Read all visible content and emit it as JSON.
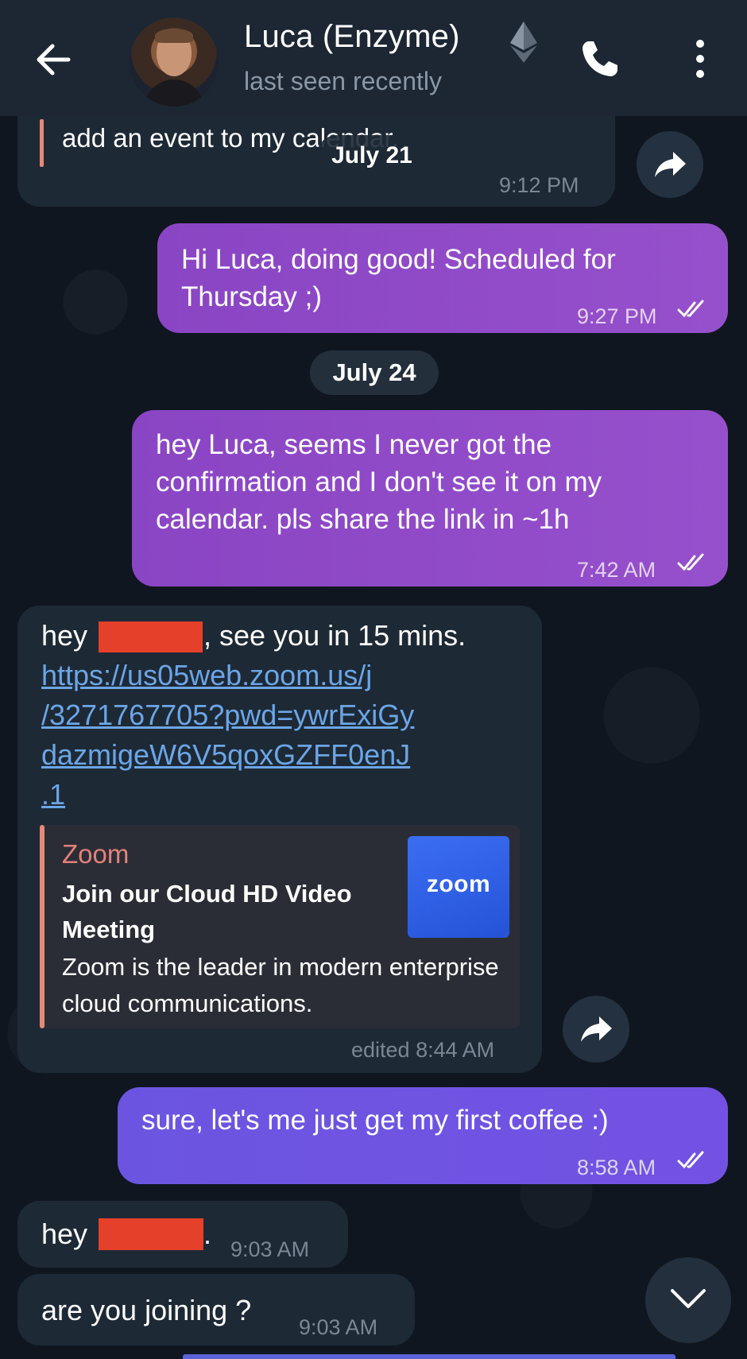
{
  "header": {
    "contact_name": "Luca (Enzyme)",
    "status": "last seen recently",
    "back_icon": "back-arrow-icon",
    "call_icon": "phone-icon",
    "menu_icon": "more-vertical-icon"
  },
  "messages": [
    {
      "id": "m0",
      "direction": "incoming",
      "text": "add an event to my calendar.",
      "time": "9:12 PM"
    },
    {
      "id": "m1",
      "direction": "outgoing",
      "lines": [
        "Hi Luca, doing good! Scheduled for",
        "Thursday ;)"
      ],
      "time": "9:27 PM",
      "read": true
    },
    {
      "id": "m2",
      "direction": "outgoing",
      "lines": [
        "hey Luca, seems I never got the",
        "confirmation and I don't see it on my",
        "calendar. pls share the  link in ~1h"
      ],
      "time": "7:42 AM",
      "read": true
    },
    {
      "id": "m3",
      "direction": "incoming",
      "greeting": "hey",
      "after_name": ", see you in 15 mins.",
      "link_lines": [
        "https://us05web.zoom.us/j",
        "/3271767705?pwd=ywrExiGy",
        "dazmigeW6V5qoxGZFF0enJ",
        ".1"
      ],
      "preview": {
        "site": "Zoom",
        "title": "Join our Cloud HD Video Meeting",
        "description": "Zoom is the leader in modern enterprise cloud communications.",
        "logo_text": "zoom"
      },
      "time": "edited 8:44 AM"
    },
    {
      "id": "m4",
      "direction": "outgoing",
      "text": "sure, let's me just get my first coffee :)",
      "time": "8:58 AM",
      "read": true
    },
    {
      "id": "m5",
      "direction": "incoming",
      "greeting": "hey",
      "after_name": ".",
      "time": "9:03 AM"
    },
    {
      "id": "m6",
      "direction": "incoming",
      "text": "are you joining ?",
      "time": "9:03 AM"
    }
  ],
  "dates": {
    "july21": "July 21",
    "july24": "July 24"
  },
  "colors": {
    "background": "#0e1621",
    "header": "#1c2733",
    "incoming_bubble": "#1e2936",
    "outgoing_bubble": "#8a45c4",
    "outgoing_bubble_latest": "#6b55e0",
    "link": "#6ba6e6",
    "redaction": "#e5402a",
    "preview_accent": "#e48a7a"
  }
}
